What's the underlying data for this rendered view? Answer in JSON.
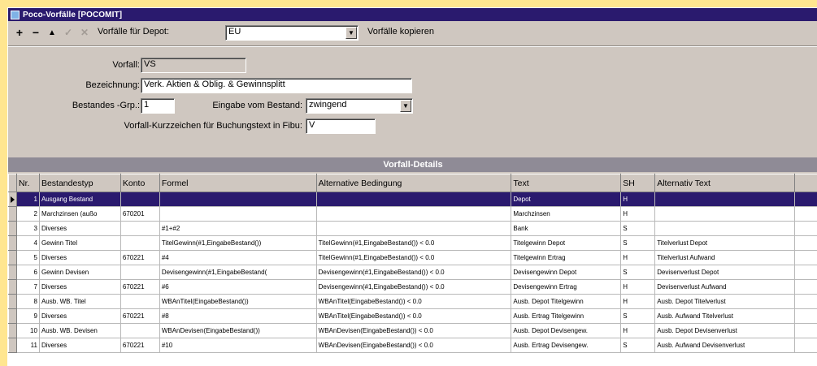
{
  "window": {
    "title": "Poco-Vorfälle [POCOMIT]"
  },
  "toolbar": {
    "add": "+",
    "remove": "−",
    "up": "▲",
    "confirm": "✓",
    "cancel": "✕",
    "depot_label": "Vorfälle für Depot:",
    "depot_value": "EU",
    "copy_label": "Vorfälle kopieren"
  },
  "form": {
    "vorfall_label": "Vorfall:",
    "vorfall_value": "VS",
    "bezeichnung_label": "Bezeichnung:",
    "bezeichnung_value": "Verk. Aktien & Oblig. & Gewinnsplitt",
    "bestandes_label": "Bestandes -Grp.:",
    "bestandes_value": "1",
    "eingabe_label": "Eingabe vom Bestand:",
    "eingabe_value": "zwingend",
    "kurz_label": "Vorfall-Kurzzeichen für Buchungstext in Fibu:",
    "kurz_value": "V"
  },
  "details": {
    "title": "Vorfall-Details",
    "columns": [
      "Nr.",
      "Bestandestyp",
      "Konto",
      "Formel",
      "Alternative Bedingung",
      "Text",
      "SH",
      "Alternativ Text"
    ],
    "rows": [
      [
        "1",
        "Ausgang Bestand",
        "",
        "",
        "",
        "Depot",
        "H",
        ""
      ],
      [
        "2",
        "Marchzinsen (außo",
        "670201",
        "",
        "",
        "Marchzinsen",
        "H",
        ""
      ],
      [
        "3",
        "Diverses",
        "",
        "#1+#2",
        "",
        "Bank",
        "S",
        ""
      ],
      [
        "4",
        "Gewinn Titel",
        "",
        "TitelGewinn(#1,EingabeBestand())",
        "TitelGewinn(#1,EingabeBestand()) < 0.0",
        "Titelgewinn Depot",
        "S",
        "Titelverlust Depot"
      ],
      [
        "5",
        "Diverses",
        "670221",
        "#4",
        "TitelGewinn(#1,EingabeBestand()) < 0.0",
        "Titelgewinn Ertrag",
        "H",
        "Titelverlust Aufwand"
      ],
      [
        "6",
        "Gewinn Devisen",
        "",
        "Devisengewinn(#1,EingabeBestand(",
        "Devisengewinn(#1,EingabeBestand()) < 0.0",
        "Devisengewinn Depot",
        "S",
        "Devisenverlust Depot"
      ],
      [
        "7",
        "Diverses",
        "670221",
        "#6",
        "Devisengewinn(#1,EingabeBestand()) < 0.0",
        "Devisengewinn Ertrag",
        "H",
        "Devisenverlust Aufwand"
      ],
      [
        "8",
        "Ausb. WB. Titel",
        "",
        "WBAnTitel(EingabeBestand())",
        "WBAnTitel(EingabeBestand()) < 0.0",
        "Ausb. Depot Titelgewinn",
        "H",
        "Ausb. Depot Titelverlust"
      ],
      [
        "9",
        "Diverses",
        "670221",
        "#8",
        "WBAnTitel(EingabeBestand()) < 0.0",
        "Ausb. Ertrag Titelgewinn",
        "S",
        "Ausb. Aufwand Titelverlust"
      ],
      [
        "10",
        "Ausb. WB. Devisen",
        "",
        "WBAnDevisen(EingabeBestand())",
        "WBAnDevisen(EingabeBestand()) < 0.0",
        "Ausb. Depot Devisengew.",
        "H",
        "Ausb. Depot Devisenverlust"
      ],
      [
        "11",
        "Diverses",
        "670221",
        "#10",
        "WBAnDevisen(EingabeBestand()) < 0.0",
        "Ausb. Ertrag Devisengew.",
        "S",
        "Ausb. Aufwand Devisenverlust"
      ]
    ]
  }
}
